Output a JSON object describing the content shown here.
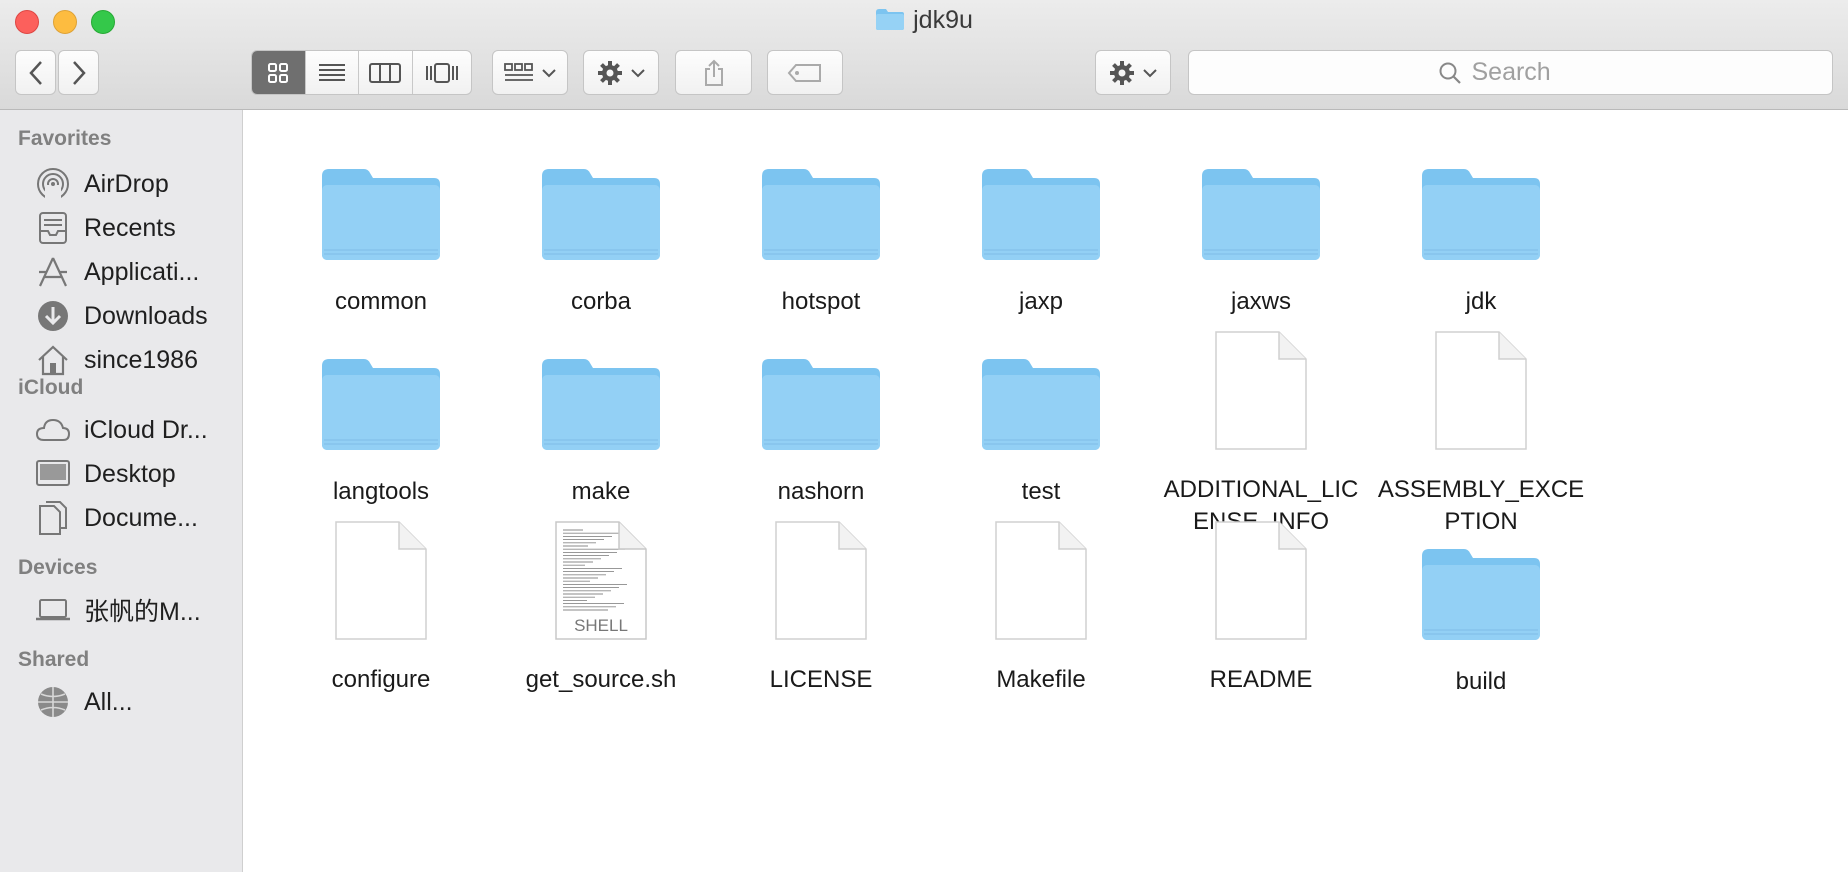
{
  "window": {
    "title": "jdk9u"
  },
  "search": {
    "placeholder": "Search"
  },
  "colors": {
    "folder": "#7cc4f0",
    "sidebar_bg": "#e9e9eb",
    "selected_view": "#6f6f6f"
  },
  "sidebar": {
    "sections": [
      {
        "title": "Favorites",
        "items": [
          {
            "label": "AirDrop",
            "icon": "airdrop-icon"
          },
          {
            "label": "Recents",
            "icon": "recents-icon"
          },
          {
            "label": "Applicati...",
            "icon": "applications-icon"
          },
          {
            "label": "Downloads",
            "icon": "downloads-icon"
          },
          {
            "label": "since1986",
            "icon": "home-icon"
          }
        ]
      },
      {
        "title": "iCloud",
        "items": [
          {
            "label": "iCloud Dr...",
            "icon": "icloud-icon"
          },
          {
            "label": "Desktop",
            "icon": "desktop-icon"
          },
          {
            "label": "Docume...",
            "icon": "documents-icon"
          }
        ]
      },
      {
        "title": "Devices",
        "items": [
          {
            "label": "张帆的M...",
            "icon": "laptop-icon"
          }
        ]
      },
      {
        "title": "Shared",
        "items": [
          {
            "label": "All...",
            "icon": "network-icon"
          }
        ]
      }
    ]
  },
  "files": [
    {
      "name": "common",
      "kind": "folder"
    },
    {
      "name": "corba",
      "kind": "folder"
    },
    {
      "name": "hotspot",
      "kind": "folder"
    },
    {
      "name": "jaxp",
      "kind": "folder"
    },
    {
      "name": "jaxws",
      "kind": "folder"
    },
    {
      "name": "jdk",
      "kind": "folder"
    },
    {
      "name": "langtools",
      "kind": "folder"
    },
    {
      "name": "make",
      "kind": "folder"
    },
    {
      "name": "nashorn",
      "kind": "folder"
    },
    {
      "name": "test",
      "kind": "folder"
    },
    {
      "name": "ADDITIONAL_LICENSE_INFO",
      "kind": "document"
    },
    {
      "name": "ASSEMBLY_EXCEPTION",
      "kind": "document"
    },
    {
      "name": "configure",
      "kind": "document"
    },
    {
      "name": "get_source.sh",
      "kind": "shell",
      "badge": "SHELL"
    },
    {
      "name": "LICENSE",
      "kind": "document"
    },
    {
      "name": "Makefile",
      "kind": "document"
    },
    {
      "name": "README",
      "kind": "document"
    },
    {
      "name": "build",
      "kind": "folder"
    }
  ]
}
